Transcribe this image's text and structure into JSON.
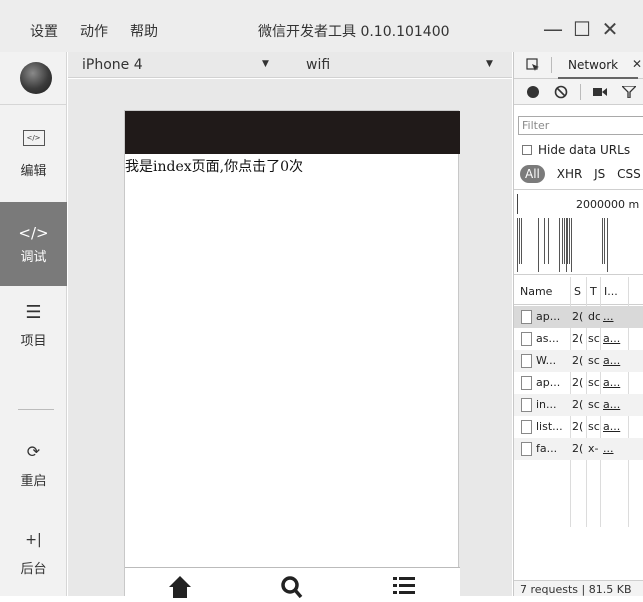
{
  "titlebar": {
    "menus": [
      "设置",
      "动作",
      "帮助"
    ],
    "title": "微信开发者工具 0.10.101400",
    "minimize": "—",
    "maximize": "☐",
    "close": "✕"
  },
  "sidebar": {
    "items": [
      {
        "label": "编辑",
        "icon": "code-file-icon"
      },
      {
        "label": "调试",
        "icon": "code-icon",
        "active": true
      },
      {
        "label": "项目",
        "icon": "menu-lines-icon"
      },
      {
        "label": "重启",
        "icon": "restart-icon"
      },
      {
        "label": "后台",
        "icon": "background-icon"
      }
    ]
  },
  "simulator": {
    "device": "iPhone 4",
    "network": "wifi",
    "page_text": "我是index页面,你点击了0次",
    "tabbar_icons": [
      "home-icon",
      "search-icon",
      "list-icon"
    ]
  },
  "devtools": {
    "tab_label": "Network",
    "filter_placeholder": "Filter",
    "hide_data_urls": "Hide data URLs",
    "types": [
      "All",
      "XHR",
      "JS",
      "CSS"
    ],
    "overview_label": "2000000 m",
    "columns": [
      "Name",
      "S",
      "T",
      "I..."
    ],
    "rows": [
      {
        "name": "ap...",
        "status": "2(",
        "type": "dc",
        "initiator": "..."
      },
      {
        "name": "as...",
        "status": "2(",
        "type": "sc",
        "initiator": "a..."
      },
      {
        "name": "W...",
        "status": "2(",
        "type": "sc",
        "initiator": "a..."
      },
      {
        "name": "ap...",
        "status": "2(",
        "type": "sc",
        "initiator": "a..."
      },
      {
        "name": "in...",
        "status": "2(",
        "type": "sc",
        "initiator": "a..."
      },
      {
        "name": "list...",
        "status": "2(",
        "type": "sc",
        "initiator": "a..."
      },
      {
        "name": "fa...",
        "status": "2(",
        "type": "x-",
        "initiator": "..."
      }
    ],
    "status_bar": "7 requests | 81.5 KB"
  }
}
